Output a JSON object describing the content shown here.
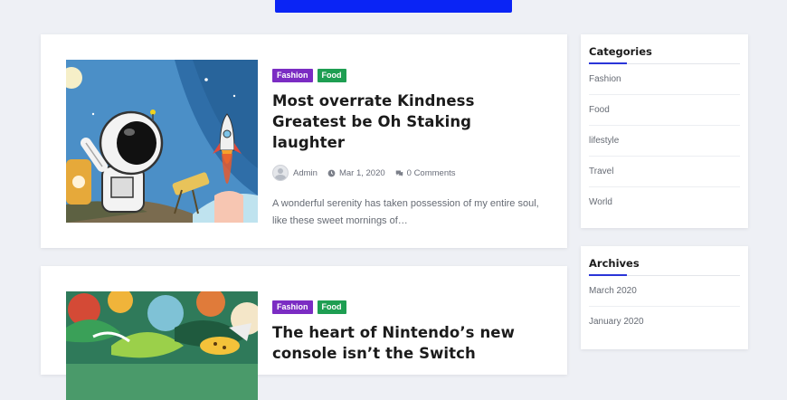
{
  "header": {
    "button_label": ""
  },
  "posts": [
    {
      "categories": [
        "Fashion",
        "Food"
      ],
      "title": "Most overrate Kindness Greatest be Oh Staking laughter",
      "author": "Admin",
      "date": "Mar 1, 2020",
      "comments": "0 Comments",
      "excerpt": "A wonderful serenity has taken possession of my entire soul, like these sweet mornings of…"
    },
    {
      "categories": [
        "Fashion",
        "Food"
      ],
      "title": "The heart of Nintendo’s new console isn’t the Switch"
    }
  ],
  "sidebar": {
    "categories": {
      "title": "Categories",
      "items": [
        "Fashion",
        "Food",
        "lifestyle",
        "Travel",
        "World"
      ]
    },
    "archives": {
      "title": "Archives",
      "items": [
        "March 2020",
        "January 2020"
      ]
    }
  },
  "colors": {
    "accent": "#2a35d8",
    "top_button": "#0a24f5",
    "badge_fashion": "#7b2cc3",
    "badge_food": "#1e9e52"
  },
  "icons": [
    "user-avatar-icon",
    "clock-icon",
    "comments-icon"
  ]
}
